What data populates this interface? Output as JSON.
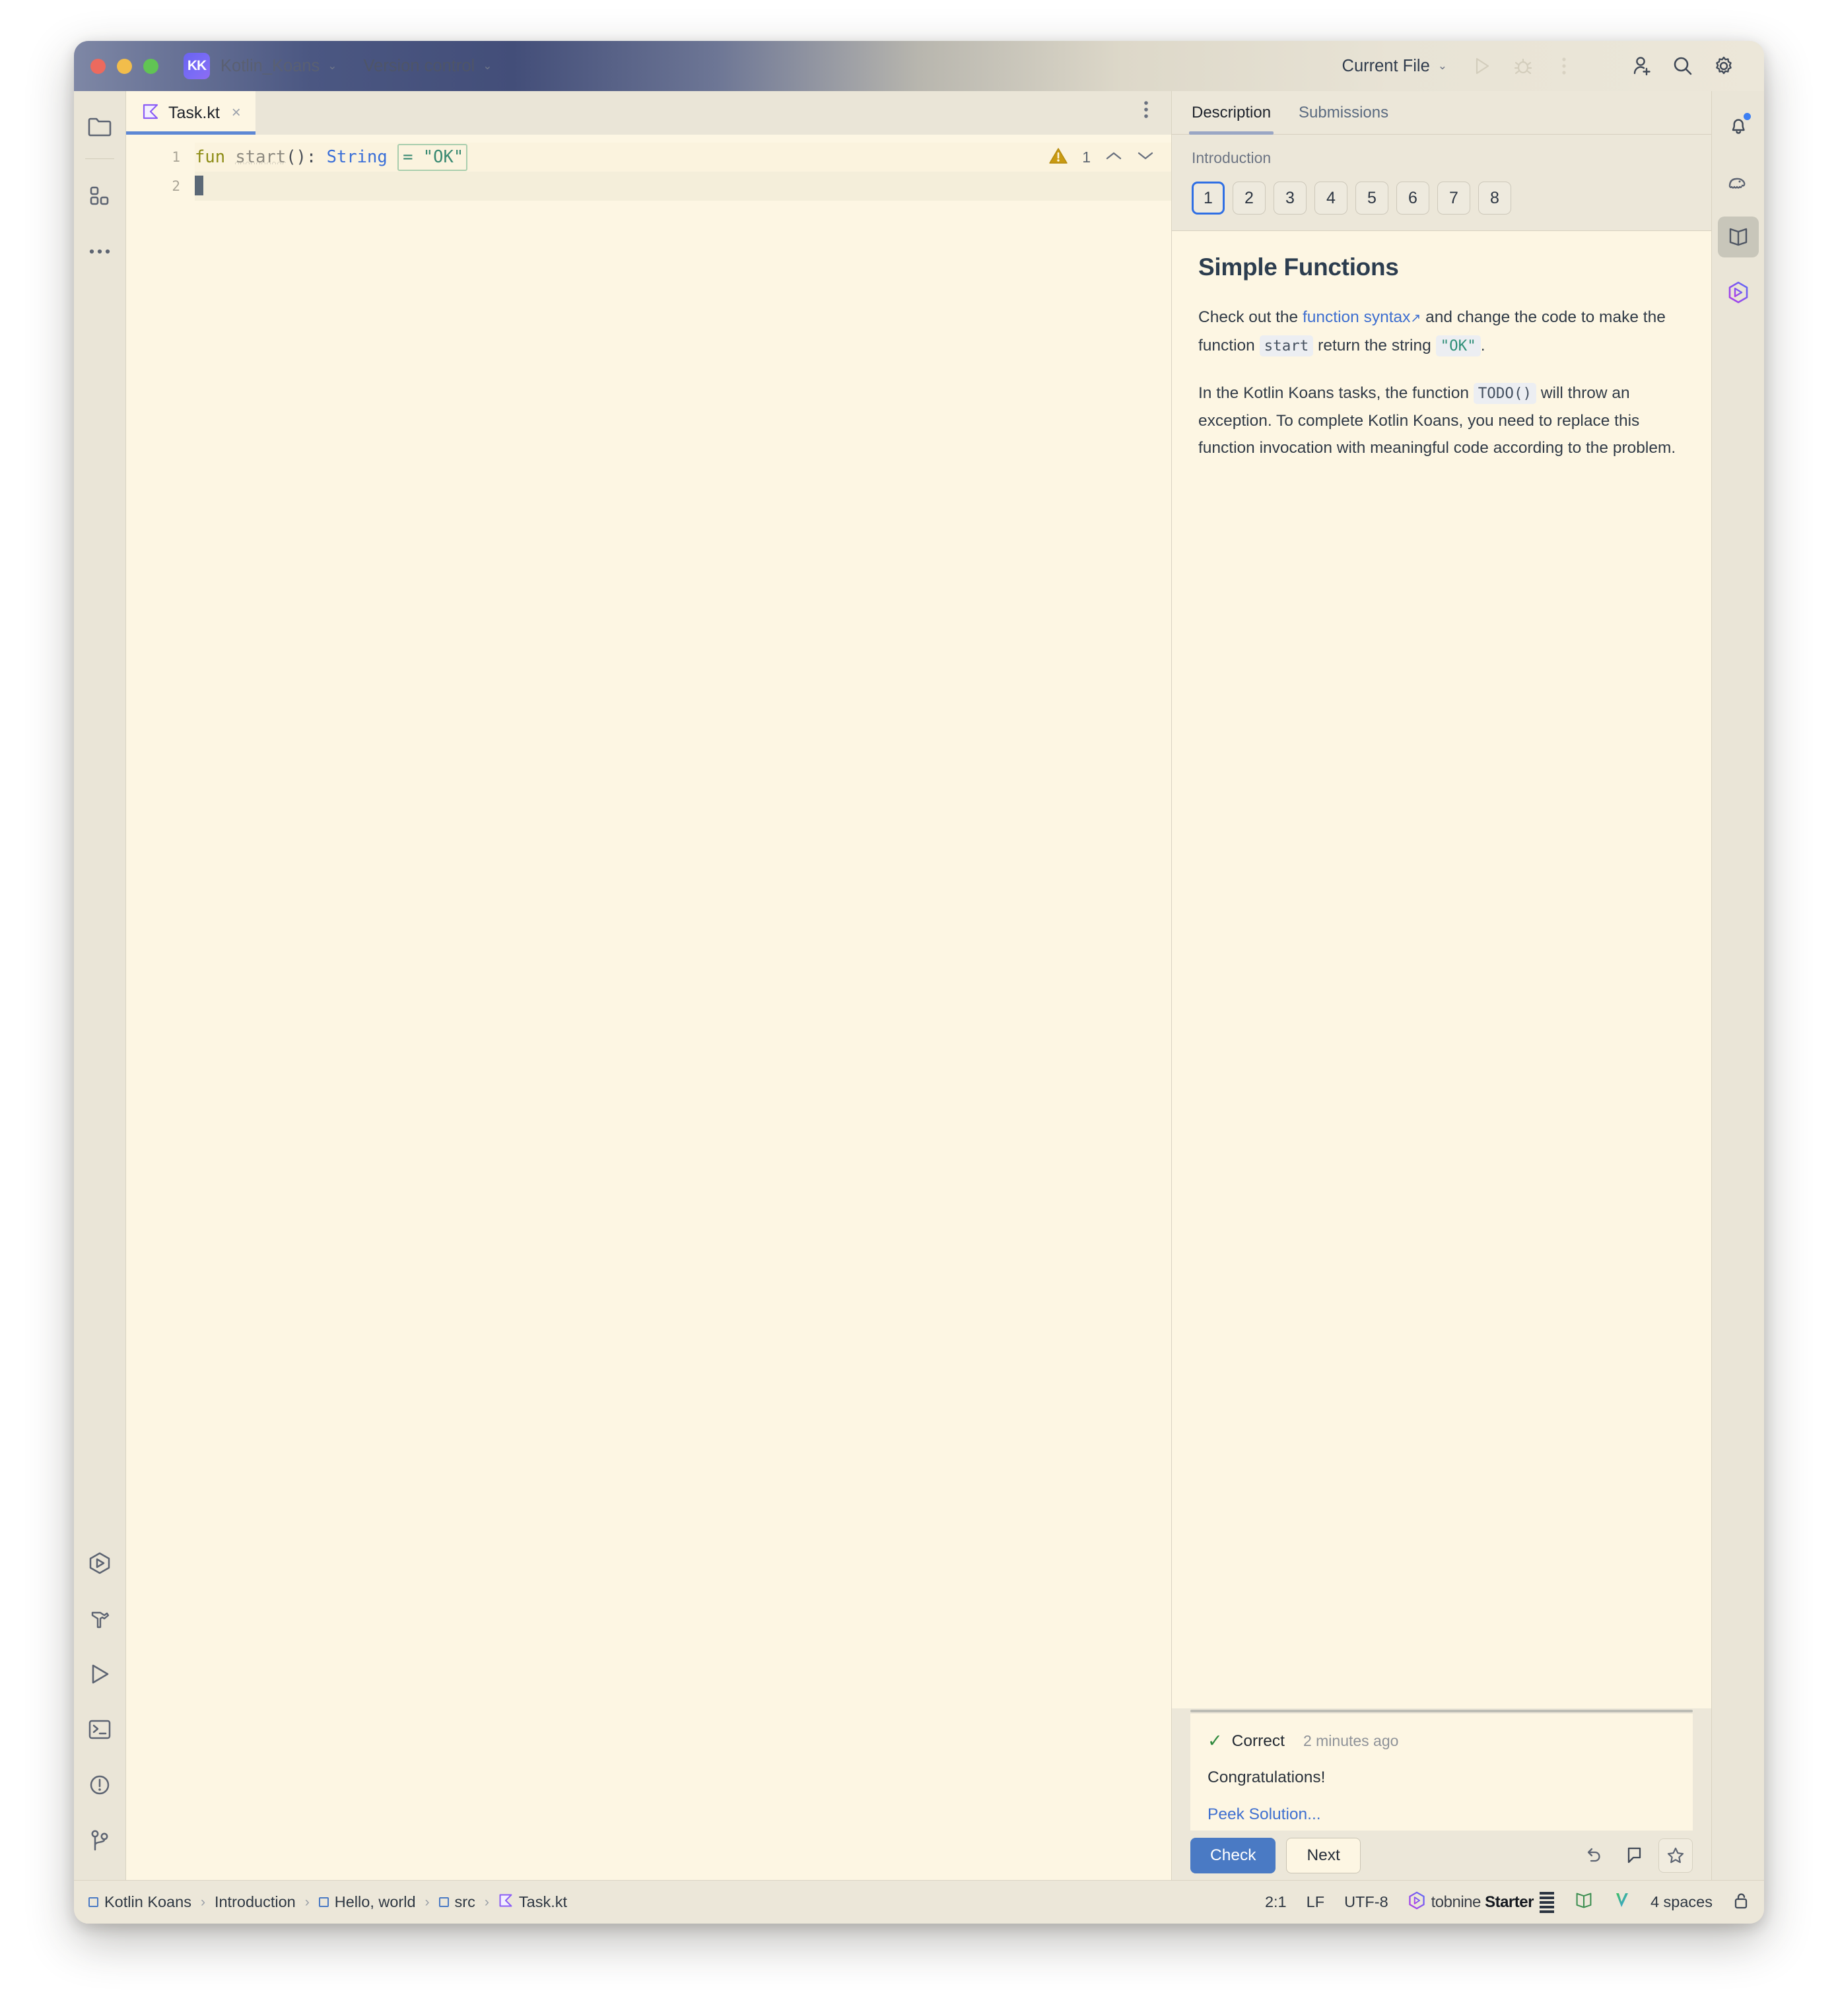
{
  "titlebar": {
    "project": "Kotlin_Koans",
    "app_initials": "KK",
    "version_control": "Version control",
    "run_config": "Current File",
    "icons": [
      "run-icon",
      "debug-icon",
      "more-icon",
      "add-user-icon",
      "search-icon",
      "settings-icon"
    ]
  },
  "left_rail": {
    "top": [
      "project-folder-icon",
      "structure-icon",
      "more-tools-icon"
    ],
    "bottom": [
      "services-icon",
      "build-icon",
      "run-tool-icon",
      "terminal-icon",
      "problems-icon",
      "git-branch-icon"
    ]
  },
  "editor": {
    "tab": {
      "name": "Task.kt",
      "close": "×"
    },
    "more_menu": "⋮",
    "line_numbers": [
      "1",
      "2"
    ],
    "code": {
      "fun_keyword": "fun",
      "fn_name": "start",
      "parens": "(): ",
      "type": "String",
      "assign_string": "= \"OK\""
    },
    "inspection": {
      "count": "1",
      "up": "⌃",
      "down": "⌄"
    }
  },
  "description": {
    "tabs": [
      {
        "label": "Description",
        "active": true
      },
      {
        "label": "Submissions",
        "active": false
      }
    ],
    "lesson": "Introduction",
    "task_numbers": [
      "1",
      "2",
      "3",
      "4",
      "5",
      "6",
      "7",
      "8"
    ],
    "selected_task": "1",
    "title": "Simple Functions",
    "para1": {
      "before_link": "Check out the ",
      "link": "function syntax",
      "link_arrow": "↗",
      "mid": " and change the code to make the function ",
      "code_fn": "start",
      "mid2": " return the string ",
      "code_str": "\"OK\"",
      "end": "."
    },
    "para2": {
      "before_code": "In the Kotlin Koans tasks, the function ",
      "code": "TODO()",
      "after_code": " will throw an exception. To complete Kotlin Koans, you need to replace this function invocation with meaningful code according to the problem."
    }
  },
  "results": {
    "status_icon": "✓",
    "status": "Correct",
    "time": "2 minutes ago",
    "message": "Congratulations!",
    "peek_solution": "Peek Solution...",
    "check_label": "Check",
    "next_label": "Next",
    "right_icons": [
      "reset-icon",
      "comment-icon",
      "star-icon"
    ]
  },
  "right_rail": {
    "icons": [
      "notifications-bell-icon",
      "gradle-elephant-icon",
      "learn-book-icon",
      "tabnine-icon"
    ],
    "active": "learn-book-icon"
  },
  "statusbar": {
    "breadcrumb": [
      "Kotlin Koans",
      "Introduction",
      "Hello, world",
      "src",
      "Task.kt"
    ],
    "caret": "2:1",
    "line_sep": "LF",
    "encoding": "UTF-8",
    "tabnine": "tobnine",
    "tabnine_plan": "Starter",
    "indent": "4 spaces"
  },
  "colors": {
    "accent_blue": "#4a7ac4",
    "tab_underline": "#5d87d4",
    "selected_task_border": "#2f6fe4",
    "correct_green": "#2f8a3e",
    "warning_amber": "#c99a12",
    "editor_bg": "#fdf6e3",
    "chrome_bg": "#ece7d9"
  }
}
